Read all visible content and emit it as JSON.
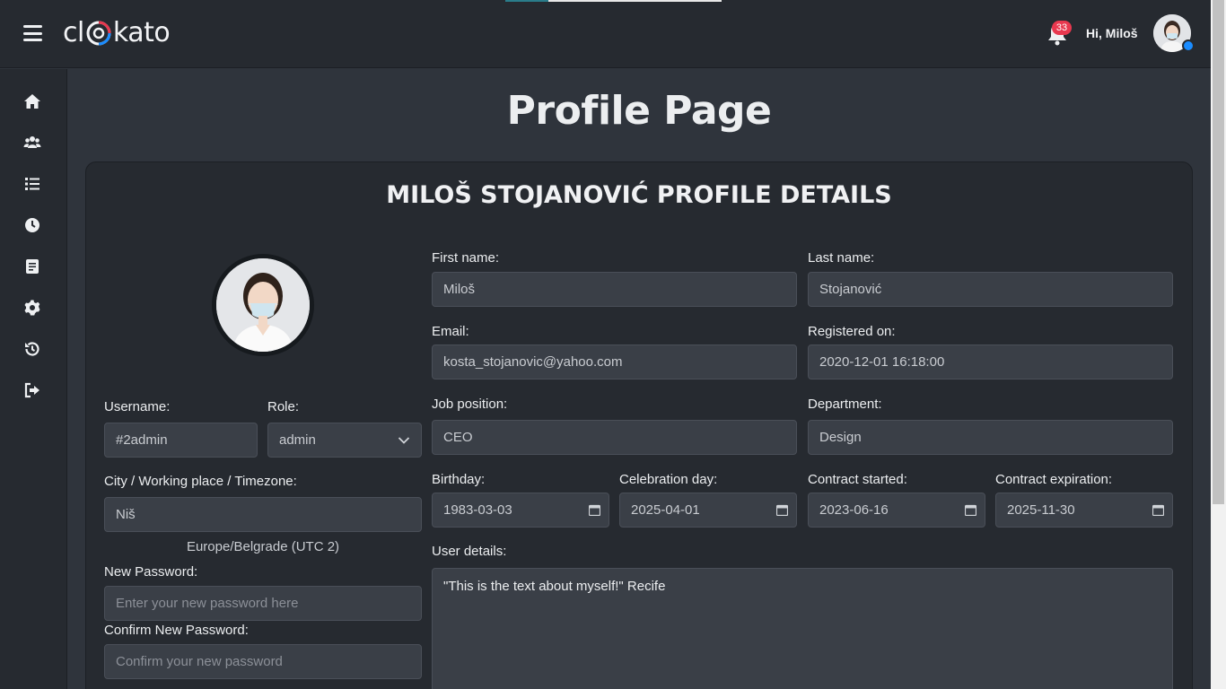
{
  "header": {
    "logo_left": "cl",
    "logo_right": "kato",
    "notification_count": "33",
    "greeting": "Hi, Miloš"
  },
  "sidebar": {
    "items": [
      {
        "icon": "home-icon"
      },
      {
        "icon": "users-icon"
      },
      {
        "icon": "list-icon"
      },
      {
        "icon": "clock-icon"
      },
      {
        "icon": "document-icon"
      },
      {
        "icon": "gear-icon"
      },
      {
        "icon": "history-icon"
      },
      {
        "icon": "logout-icon"
      }
    ]
  },
  "page": {
    "title": "Profile Page",
    "card_title": "MILOŠ STOJANOVIĆ PROFILE DETAILS"
  },
  "form": {
    "username_label": "Username:",
    "username_value": "#2admin",
    "role_label": "Role:",
    "role_value": "admin",
    "city_label": "City / Working place / Timezone:",
    "city_value": "Niš",
    "timezone": "Europe/Belgrade (UTC 2)",
    "new_password_label": "New Password:",
    "new_password_placeholder": "Enter your new password here",
    "confirm_password_label": "Confirm New Password:",
    "confirm_password_placeholder": "Confirm your new password",
    "first_name_label": "First name:",
    "first_name_value": "Miloš",
    "last_name_label": "Last name:",
    "last_name_value": "Stojanović",
    "email_label": "Email:",
    "email_value": "kosta_stojanovic@yahoo.com",
    "registered_label": "Registered on:",
    "registered_value": "2020-12-01 16:18:00",
    "job_label": "Job position:",
    "job_value": "CEO",
    "department_label": "Department:",
    "department_value": "Design",
    "birthday_label": "Birthday:",
    "birthday_value": "1983-03-03",
    "celebration_label": "Celebration day:",
    "celebration_value": "2025-04-01",
    "contract_started_label": "Contract started:",
    "contract_started_value": "2023-06-16",
    "contract_expiration_label": "Contract expiration:",
    "contract_expiration_value": "2025-11-30",
    "user_details_label": "User details:",
    "user_details_value": "\"This is the text about myself!\"  Recife"
  },
  "colors": {
    "background": "#2f343c",
    "panel": "#262a30",
    "field": "#3a3f47",
    "badge": "#e8384f",
    "status_dot": "#1a8cff",
    "logo_accent_red": "#e8384f",
    "logo_accent_blue": "#1a8cff"
  }
}
